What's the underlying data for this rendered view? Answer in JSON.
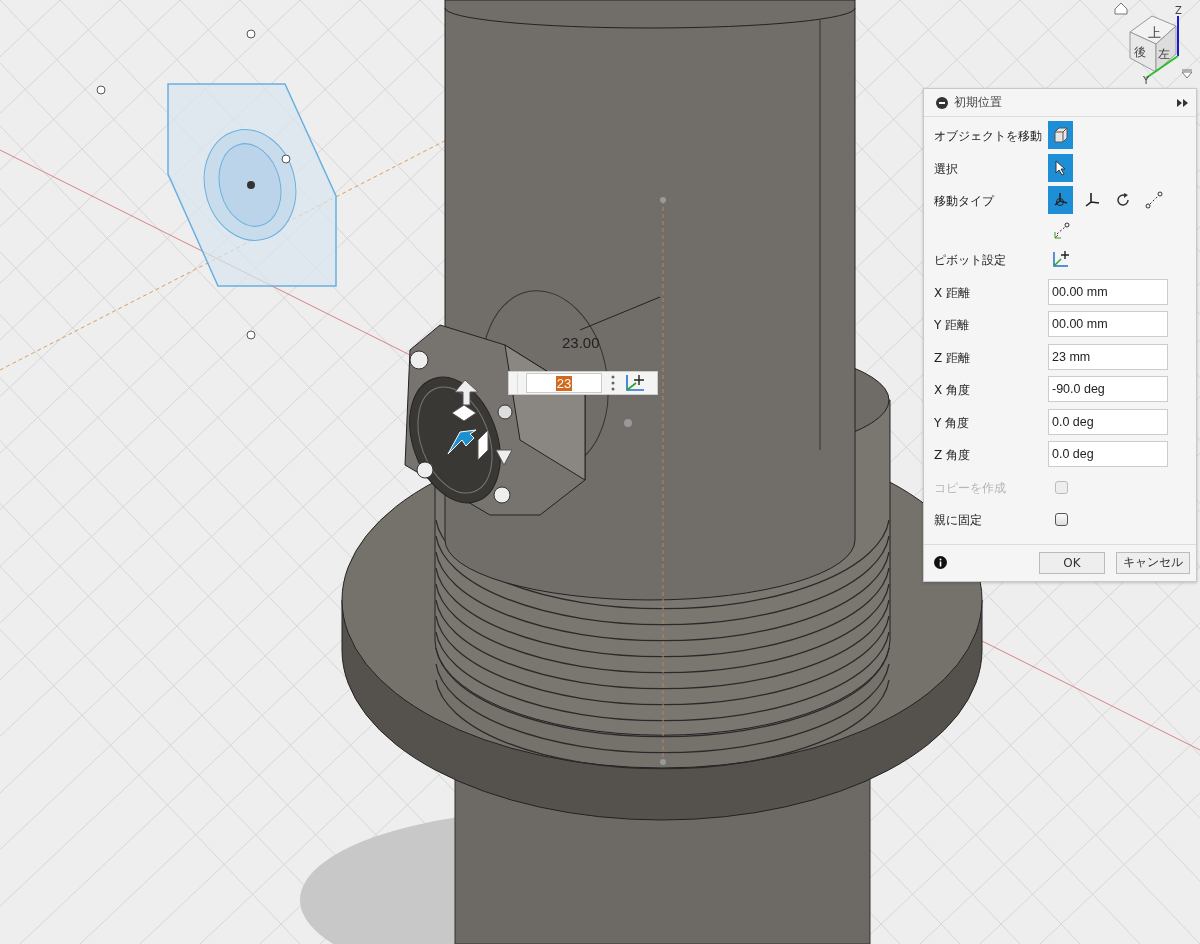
{
  "viewcube": {
    "faces": [
      "上",
      "後",
      "左"
    ],
    "axes": [
      "Z",
      "Y"
    ]
  },
  "viewport": {
    "dimension_label": "23.00",
    "input_value": "23"
  },
  "dialog": {
    "title": "初期位置",
    "rows": [
      {
        "kind": "icons",
        "label": "オブジェクトを移動",
        "icons": [
          {
            "kind": "cube",
            "selected": true
          }
        ]
      },
      {
        "kind": "icons",
        "label": "選択",
        "icons": [
          {
            "kind": "pointer",
            "selected": true
          }
        ]
      },
      {
        "kind": "icons",
        "label": "移動タイプ",
        "icons": [
          {
            "kind": "free-move",
            "selected": true
          },
          {
            "kind": "translate",
            "selected": false
          },
          {
            "kind": "rotate",
            "selected": false
          },
          {
            "kind": "point-to-point",
            "selected": false
          },
          {
            "kind": "point-to-position",
            "selected": false
          }
        ]
      },
      {
        "kind": "icons",
        "label": "ピボット設定",
        "icons": [
          {
            "kind": "pivot",
            "selected": false
          }
        ]
      },
      {
        "kind": "field",
        "label": "X 距離",
        "value": "00.00 mm"
      },
      {
        "kind": "field",
        "label": "Y 距離",
        "value": "00.00 mm"
      },
      {
        "kind": "field",
        "label": "Z 距離",
        "value": "23 mm"
      },
      {
        "kind": "field",
        "label": "X 角度",
        "value": "-90.0 deg"
      },
      {
        "kind": "field",
        "label": "Y 角度",
        "value": "0.0 deg"
      },
      {
        "kind": "field",
        "label": "Z 角度",
        "value": "0.0 deg"
      },
      {
        "kind": "checkbox",
        "label": "コピーを作成",
        "checked": false,
        "disabled": true
      },
      {
        "kind": "checkbox",
        "label": "親に固定",
        "checked": false,
        "disabled": false
      }
    ],
    "buttons": [
      "OK",
      "キャンセル"
    ]
  }
}
